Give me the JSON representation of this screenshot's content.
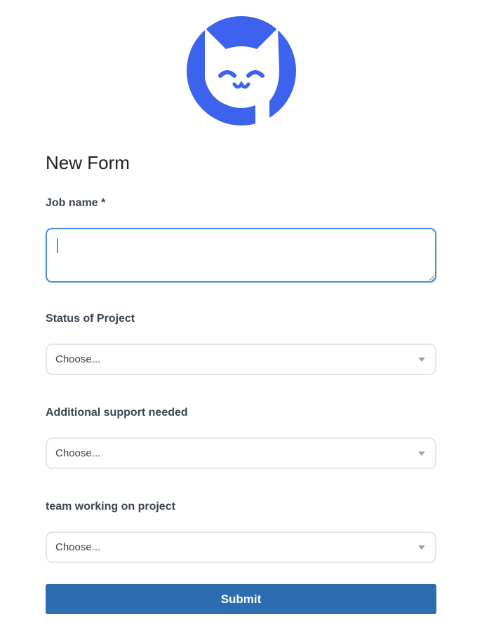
{
  "logo": {
    "icon": "smiling-cat-logo",
    "color": "#3d62ee"
  },
  "form": {
    "title": "New Form",
    "fields": {
      "job_name": {
        "label": "Job name *",
        "value": ""
      },
      "status": {
        "label": "Status of Project",
        "value": "Choose..."
      },
      "support": {
        "label": "Additional support needed",
        "value": "Choose..."
      },
      "team": {
        "label": "team working on project",
        "value": "Choose..."
      }
    },
    "submit_label": "Submit"
  },
  "colors": {
    "primary_button": "#2c6cb0",
    "focus_border": "#4a90d9",
    "label_text": "#3c4453"
  }
}
